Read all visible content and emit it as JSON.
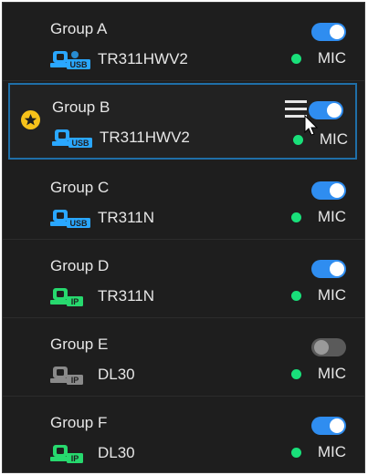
{
  "groups": [
    {
      "name": "Group A",
      "model": "TR311HWV2",
      "camera_type": "USB",
      "enabled": true,
      "mic_label": "MIC",
      "selected": false
    },
    {
      "name": "Group B",
      "model": "TR311HWV2",
      "camera_type": "USB",
      "enabled": true,
      "mic_label": "MIC",
      "selected": true
    },
    {
      "name": "Group C",
      "model": "TR311N",
      "camera_type": "USB",
      "enabled": true,
      "mic_label": "MIC",
      "selected": false
    },
    {
      "name": "Group D",
      "model": "TR311N",
      "camera_type": "IP",
      "enabled": true,
      "mic_label": "MIC",
      "selected": false
    },
    {
      "name": "Group E",
      "model": "DL30",
      "camera_type": "IP",
      "enabled": false,
      "mic_label": "MIC",
      "selected": false
    },
    {
      "name": "Group F",
      "model": "DL30",
      "camera_type": "IP",
      "enabled": true,
      "mic_label": "MIC",
      "selected": false
    }
  ],
  "colors": {
    "usb_camera": "#2aa7ff",
    "ip_camera": "#27d96e",
    "disabled_camera": "#8a8a8a",
    "mic_status": "#19e07a",
    "toggle_on": "#2f8df0",
    "selection_border": "#1f6fa8",
    "favorite_star": "#f7c21a"
  },
  "icons": {
    "favorite": "star-icon",
    "reorder": "hamburger-menu-icon",
    "cursor": "pointer-cursor-icon"
  }
}
